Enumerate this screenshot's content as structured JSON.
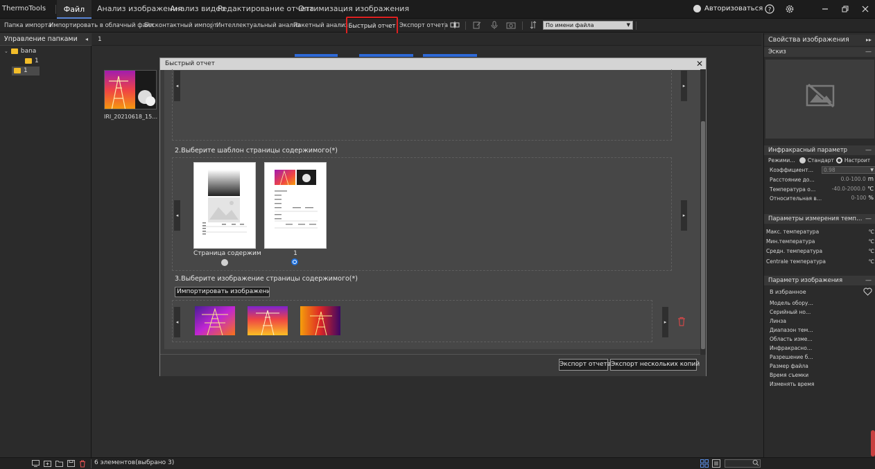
{
  "app": {
    "title": "ThermoTools"
  },
  "menu": {
    "file": "Файл",
    "image_analysis": "Анализ изображения",
    "video_analysis": "Анализ видео",
    "report_edit": "Редактирование отчета",
    "image_optimize": "Оптимизация изображения",
    "login": "Авторизоваться"
  },
  "toolbar": {
    "import_folder": "Папка импорта",
    "import_cloud": "Импортировать в облачный файл",
    "contactless_import": "Бесконтактный импорт",
    "intelligent_analysis": "Интеллектуальный анализ",
    "batch_analysis": "Пакетный анализ",
    "quick_report": "Быстрый отчет",
    "export_report": "Экспорт отчета",
    "sort_value": "По имени файла"
  },
  "left_panel": {
    "header": "Управление папками",
    "tree": [
      {
        "label": "bana"
      },
      {
        "label": "1"
      },
      {
        "label": "1"
      }
    ]
  },
  "content": {
    "tab_label": "1",
    "thumb_name": "IRI_20210618_15…"
  },
  "dialog": {
    "title": "Быстрый отчет",
    "step2": "2.Выберите шаблон страницы содержимого(*)",
    "template1_caption": "Страница содержим",
    "template2_caption": "1",
    "step3": "3.Выберите изображение страницы содержимого(*)",
    "import_image": "Импортировать изображение",
    "export_report": "Экспорт отчета",
    "export_multiple": "Экспорт нескольких копий"
  },
  "right_panel": {
    "header": "Свойства изображения",
    "sketch": "Эскиз",
    "ir_param": {
      "title": "Инфракрасный параметр",
      "mode_label": "Режими…",
      "mode_standard": "Стандарт",
      "mode_custom": "Настроит",
      "coef_label": "Коэффициент…",
      "coef_value": "0.98",
      "distance_label": "Расстояние до…",
      "distance_value": "0.0-100.0",
      "distance_unit": "m",
      "temp_label": "Температура о…",
      "temp_value": "-40.0-2000.0",
      "temp_unit": "℃",
      "humidity_label": "Относительная в…",
      "humidity_value": "0-100",
      "humidity_unit": "%"
    },
    "measure": {
      "title": "Параметры измерения темп…",
      "rows": [
        {
          "label": "Макс. температура",
          "unit": "℃"
        },
        {
          "label": "Мин.температура",
          "unit": "℃"
        },
        {
          "label": "Средн. температура",
          "unit": "℃"
        },
        {
          "label": "Centrale температура",
          "unit": "℃"
        }
      ]
    },
    "image_param": {
      "title": "Параметр изображения",
      "favorite": "В избранное",
      "rows": [
        "Модель обору…",
        "Серийный но…",
        "Линза",
        "Диапазон тем…",
        "Область изме…",
        "Инфракрасно…",
        "Разрешение б…",
        "Размер файла",
        "Время съемки",
        "Изменять время"
      ]
    }
  },
  "status": {
    "text": "6 элементов(выбрано 3)"
  },
  "colors": {
    "accent": "#1e6fd9",
    "highlight": "#e02020",
    "folder": "#f2bd2a"
  }
}
